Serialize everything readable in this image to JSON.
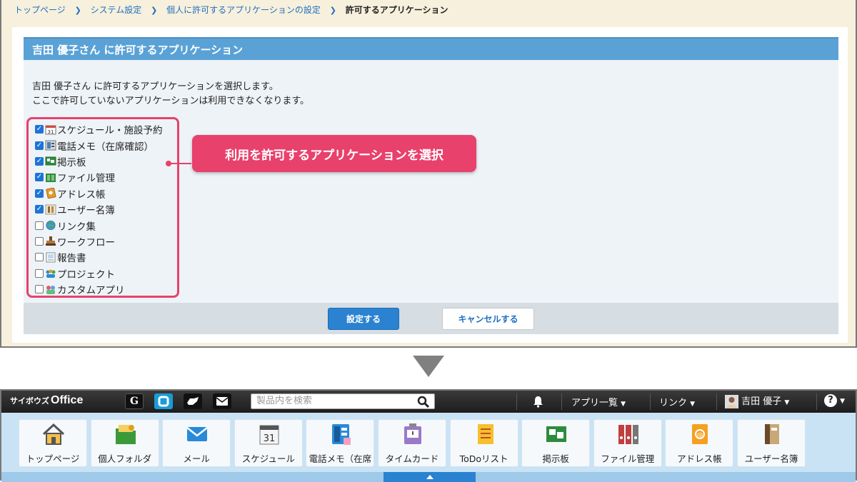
{
  "breadcrumb": {
    "items": [
      "トップページ",
      "システム設定",
      "個人に許可するアプリケーションの設定"
    ],
    "current": "許可するアプリケーション"
  },
  "panel": {
    "title": "吉田 優子さん に許可するアプリケーション",
    "desc_line1": "吉田 優子さん に許可するアプリケーションを選択します。",
    "desc_line2": "ここで許可していないアプリケーションは利用できなくなります。"
  },
  "apps": [
    {
      "label": "スケジュール・施設予約",
      "checked": true,
      "icon": "calendar-icon"
    },
    {
      "label": "電話メモ（在席確認）",
      "checked": true,
      "icon": "phone-memo-icon"
    },
    {
      "label": "掲示板",
      "checked": true,
      "icon": "bulletin-board-icon"
    },
    {
      "label": "ファイル管理",
      "checked": true,
      "icon": "file-management-icon"
    },
    {
      "label": "アドレス帳",
      "checked": true,
      "icon": "address-book-icon"
    },
    {
      "label": "ユーザー名簿",
      "checked": true,
      "icon": "user-directory-icon"
    },
    {
      "label": "リンク集",
      "checked": false,
      "icon": "link-collection-icon"
    },
    {
      "label": "ワークフロー",
      "checked": false,
      "icon": "workflow-icon"
    },
    {
      "label": "報告書",
      "checked": false,
      "icon": "report-icon"
    },
    {
      "label": "プロジェクト",
      "checked": false,
      "icon": "project-icon"
    },
    {
      "label": "カスタムアプリ",
      "checked": false,
      "icon": "custom-app-icon"
    }
  ],
  "callout": "利用を許可するアプリケーションを選択",
  "buttons": {
    "save": "設定する",
    "cancel": "キャンセルする"
  },
  "header": {
    "logo_small": "サイボウズ",
    "logo_main": "Office",
    "search_placeholder": "製品内を検索",
    "app_list": "アプリ一覧",
    "links": "リンク",
    "user": "吉田 優子",
    "help": "?"
  },
  "tiles": [
    {
      "label": "トップページ",
      "icon": "home-icon"
    },
    {
      "label": "個人フォルダ",
      "icon": "personal-folder-icon"
    },
    {
      "label": "メール",
      "icon": "mail-icon"
    },
    {
      "label": "スケジュール",
      "icon": "calendar-icon"
    },
    {
      "label": "電話メモ（在席",
      "icon": "phone-memo-icon"
    },
    {
      "label": "タイムカード",
      "icon": "timecard-icon"
    },
    {
      "label": "ToDoリスト",
      "icon": "todo-list-icon"
    },
    {
      "label": "掲示板",
      "icon": "bulletin-board-icon"
    },
    {
      "label": "ファイル管理",
      "icon": "file-management-icon"
    },
    {
      "label": "アドレス帳",
      "icon": "address-book-icon"
    },
    {
      "label": "ユーザー名簿",
      "icon": "user-directory-icon"
    }
  ],
  "colors": {
    "accent_pink": "#e8416c",
    "title_blue": "#5aa2d6",
    "primary_button": "#2a82d1",
    "header_dark": "#262626"
  }
}
